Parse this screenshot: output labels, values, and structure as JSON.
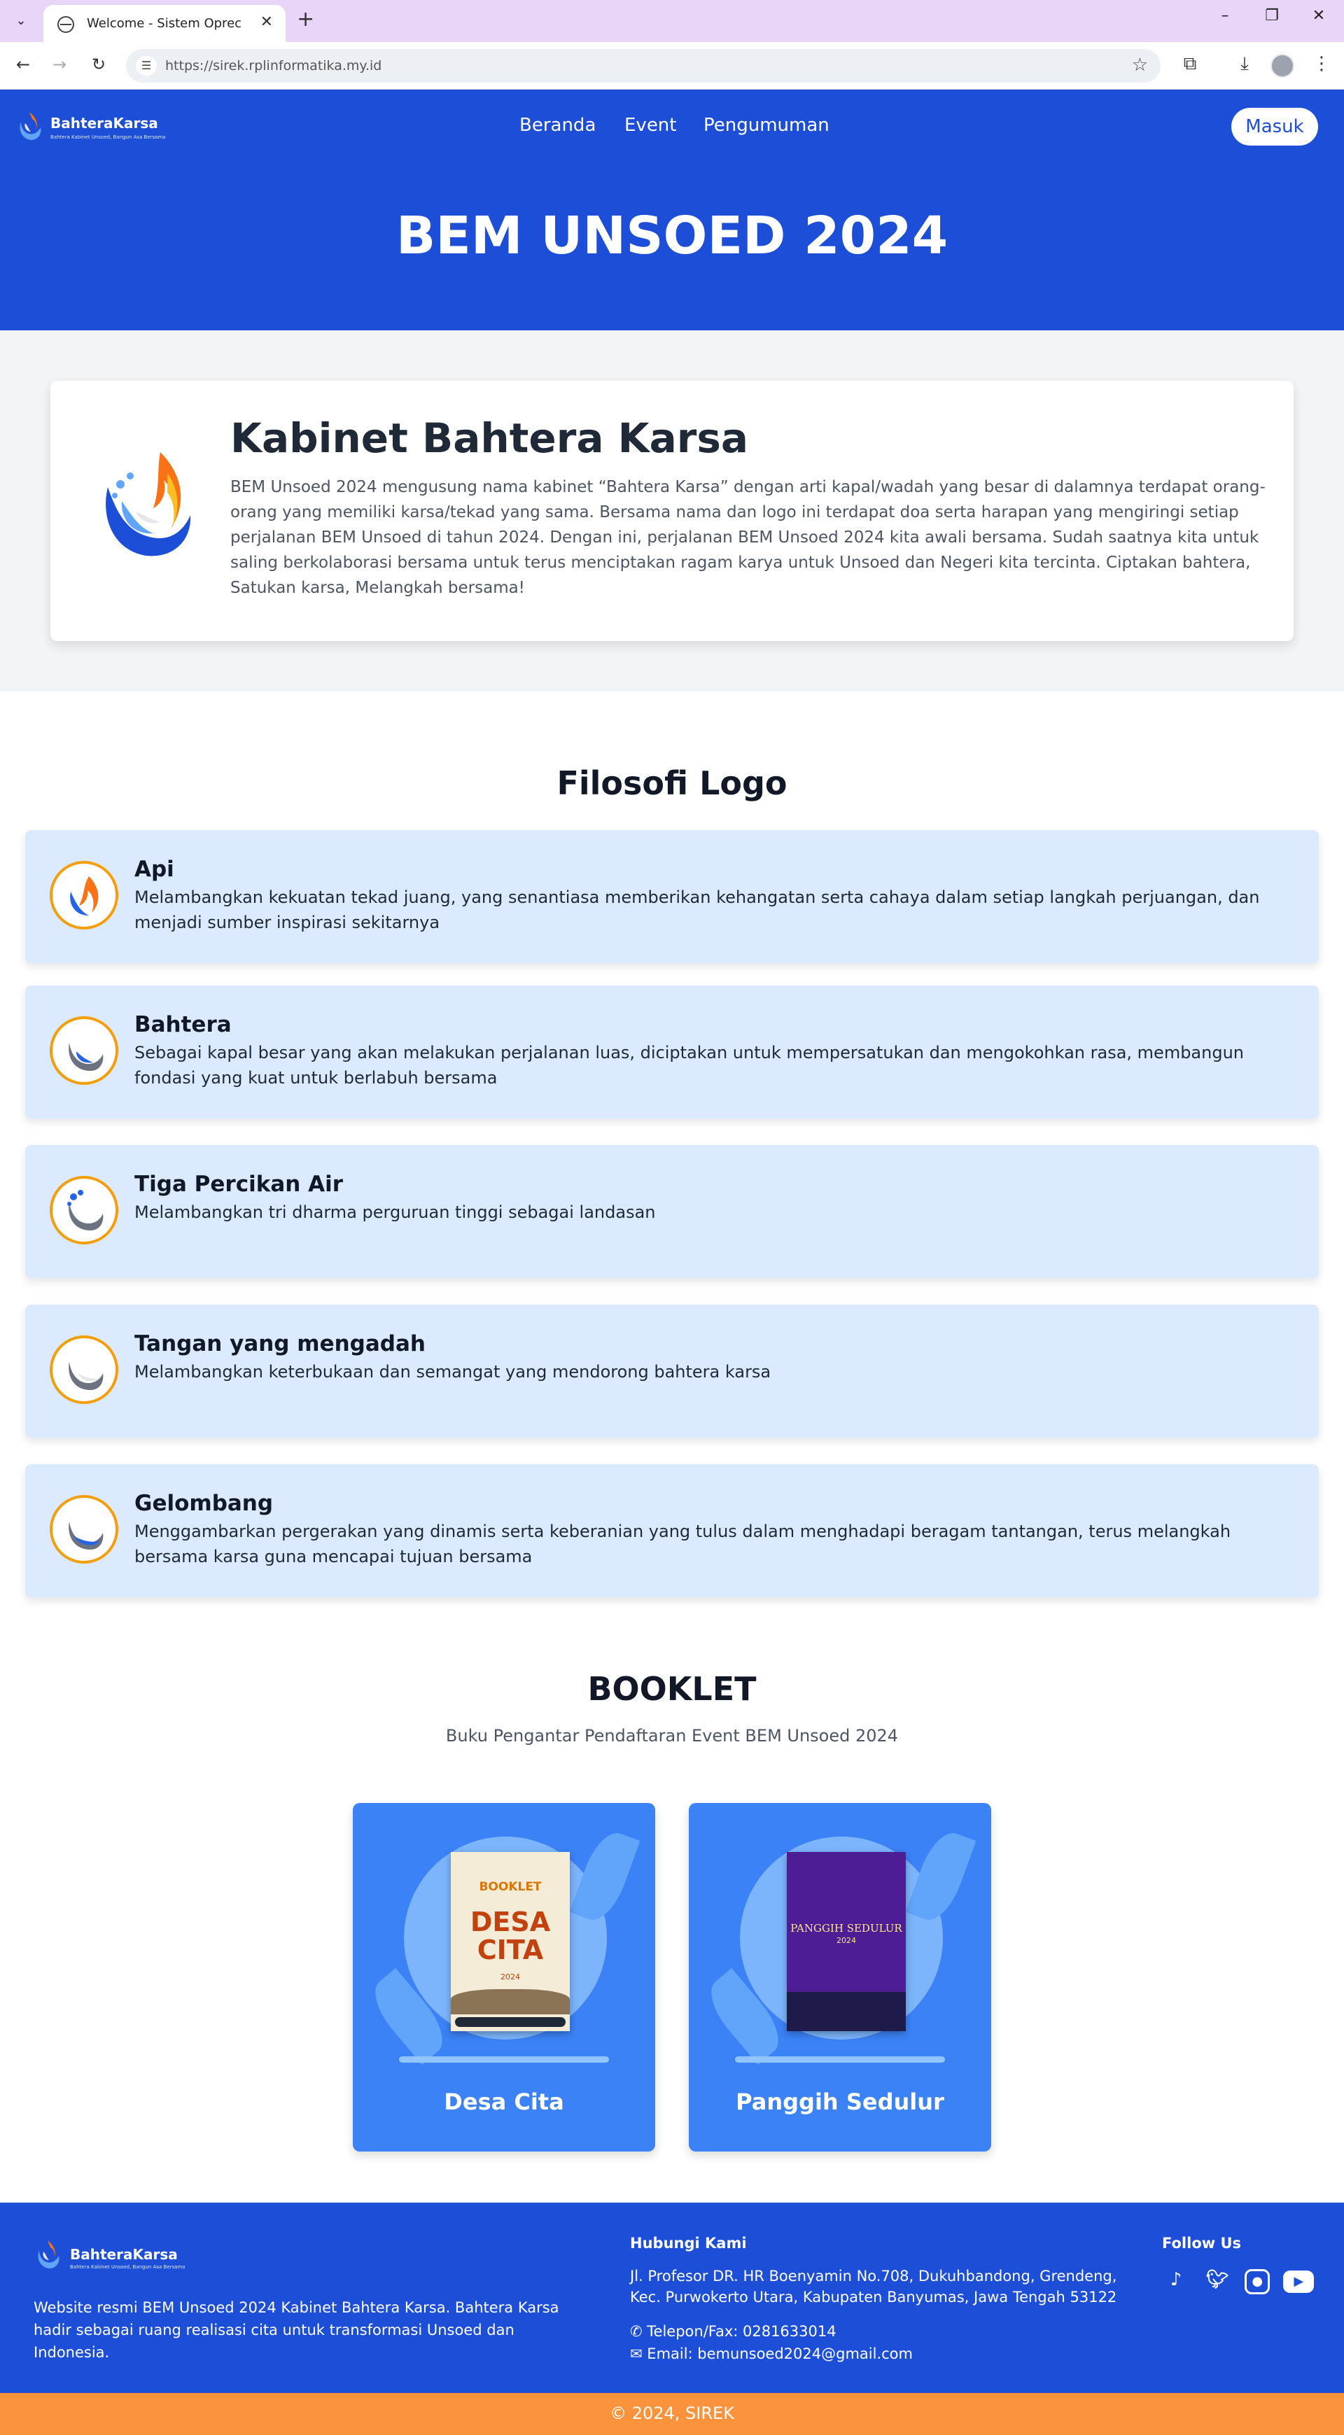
{
  "browser": {
    "tab_title": "Welcome - Sistem Oprec",
    "url": "https://sirek.rplinformatika.my.id",
    "tab_menu_icon": "chevron-down-icon",
    "close_icon": "close-icon",
    "new_tab_icon": "plus-icon"
  },
  "nav": {
    "brand_name": "BahteraKarsa",
    "brand_tagline": "Bahtera Kabinet Unsoed, Bangun Asa Bersama",
    "menu": [
      "Beranda",
      "Event",
      "Pengumuman"
    ],
    "login_label": "Masuk"
  },
  "hero": {
    "title": "BEM UNSOED 2024"
  },
  "about": {
    "title": "Kabinet Bahtera Karsa",
    "text": "BEM Unsoed 2024 mengusung nama kabinet “Bahtera Karsa” dengan arti kapal/wadah yang besar di dalamnya terdapat orang-orang yang memiliki karsa/tekad yang sama. Bersama nama dan logo ini terdapat doa serta harapan yang mengiringi setiap perjalanan BEM Unsoed di tahun 2024. Dengan ini, perjalanan BEM Unsoed 2024 kita awali bersama. Sudah saatnya kita untuk saling berkolaborasi bersama untuk terus menciptakan ragam karya untuk Unsoed dan Negeri kita tercinta. Ciptakan bahtera, Satukan karsa, Melangkah bersama!"
  },
  "filosofi": {
    "title": "Filosofi Logo",
    "items": [
      {
        "title": "Api",
        "desc": "Melambangkan kekuatan tekad juang, yang senantiasa memberikan kehangatan serta cahaya dalam setiap langkah perjuangan, dan menjadi sumber inspirasi sekitarnya"
      },
      {
        "title": "Bahtera",
        "desc": "Sebagai kapal besar yang akan melakukan perjalanan luas, diciptakan untuk mempersatukan dan mengokohkan rasa, membangun fondasi yang kuat untuk berlabuh bersama"
      },
      {
        "title": "Tiga Percikan Air",
        "desc": "Melambangkan tri dharma perguruan tinggi sebagai landasan"
      },
      {
        "title": "Tangan yang mengadah",
        "desc": "Melambangkan keterbukaan dan semangat yang mendorong bahtera karsa"
      },
      {
        "title": "Gelombang",
        "desc": "Menggambarkan pergerakan yang dinamis serta keberanian yang tulus dalam menghadapi beragam tantangan, terus melangkah bersama karsa guna mencapai tujuan bersama"
      }
    ]
  },
  "booklet": {
    "title": "BOOKLET",
    "subtitle": "Buku Pengantar Pendaftaran Event BEM Unsoed 2024",
    "items": [
      {
        "label": "Desa Cita",
        "cover_line1": "BOOKLET",
        "cover_line2": "DESA CITA",
        "cover_year": "2024"
      },
      {
        "label": "Panggih Sedulur",
        "cover_line1": "PANGGIH SEDULUR",
        "cover_year": "2024"
      }
    ]
  },
  "footer": {
    "brand_name": "BahteraKarsa",
    "brand_tagline": "Bahtera Kabinet Unsoed, Bangun Asa Bersama",
    "description": "Website resmi BEM Unsoed 2024 Kabinet Bahtera Karsa. Bahtera Karsa hadir sebagai ruang realisasi cita untuk transformasi Unsoed dan Indonesia.",
    "contact_title": "Hubungi Kami",
    "address": "Jl. Profesor DR. HR Boenyamin No.708, Dukuhbandong, Grendeng, Kec. Purwokerto Utara, Kabupaten Banyumas, Jawa Tengah 53122",
    "phone": "Telepon/Fax: 0281633014",
    "email": "Email: bemunsoed2024@gmail.com",
    "follow_title": "Follow Us",
    "socials": [
      "tiktok-icon",
      "twitter-icon",
      "instagram-icon",
      "youtube-icon"
    ],
    "copyright": "© 2024, SIREK"
  }
}
